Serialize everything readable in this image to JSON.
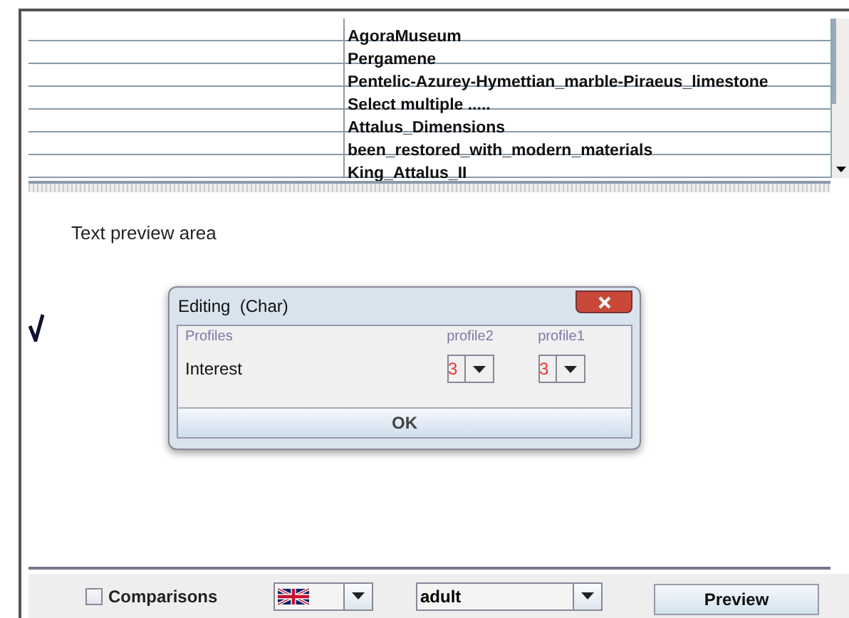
{
  "table": {
    "rows": [
      "AgoraMuseum",
      "Pergamene",
      "Pentelic-Azurey-Hymettian_marble-Piraeus_limestone",
      "Select multiple .....",
      "Attalus_Dimensions",
      "been_restored_with_modern_materials",
      "King_Attalus_II"
    ]
  },
  "preview": {
    "text": "Text preview area"
  },
  "dialog": {
    "title": "Editing  (Char)",
    "header": "Profiles",
    "columns": [
      "profile2",
      "profile1"
    ],
    "row_label": "Interest",
    "values": [
      "3",
      "3"
    ],
    "ok": "OK"
  },
  "bottom": {
    "comparisons": {
      "label": "Comparisons",
      "checked": false
    },
    "audience": "adult",
    "preview_button": "Preview"
  }
}
